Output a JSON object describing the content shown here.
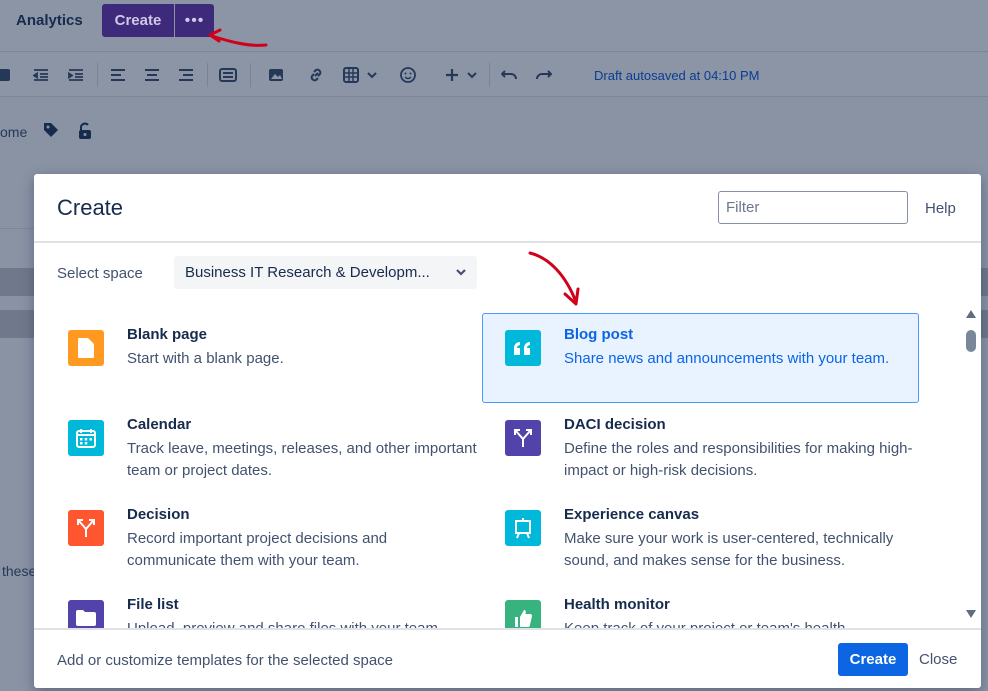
{
  "topbar": {
    "analytics_label": "Analytics",
    "create_label": "Create",
    "more_label": "•••"
  },
  "toolbar": {
    "draft_status": "Draft autosaved at 04:10 PM",
    "icons": [
      "checkbox-icon",
      "outdent-icon",
      "indent-icon",
      "align-left-icon",
      "align-center-icon",
      "align-right-icon",
      "layout-icon",
      "image-icon",
      "link-icon",
      "table-icon",
      "chevron-down-icon",
      "emoji-icon",
      "plus-icon",
      "chevron-down-icon",
      "undo-icon",
      "redo-icon"
    ]
  },
  "page": {
    "partial_home_text": "ome",
    "partial_body_text": "these"
  },
  "modal": {
    "title": "Create",
    "filter_placeholder": "Filter",
    "help_label": "Help",
    "select_space_label": "Select space",
    "selected_space": "Business IT Research & Developm...",
    "templates": [
      {
        "title": "Blank page",
        "description": "Start with a blank page.",
        "icon": "blank-page-icon",
        "color": "#ff991f",
        "selected": false
      },
      {
        "title": "Blog post",
        "description": "Share news and announcements with your team.",
        "icon": "quote-icon",
        "color": "#00b8d9",
        "selected": true
      },
      {
        "title": "Calendar",
        "description": "Track leave, meetings, releases, and other important team or project dates.",
        "icon": "calendar-icon",
        "color": "#00b8d9",
        "selected": false
      },
      {
        "title": "DACI decision",
        "description": "Define the roles and responsibilities for making high-impact or high-risk decisions.",
        "icon": "decision-fork-icon",
        "color": "#5243aa",
        "selected": false
      },
      {
        "title": "Decision",
        "description": "Record important project decisions and communicate them with your team.",
        "icon": "decision-fork-icon",
        "color": "#ff5630",
        "selected": false
      },
      {
        "title": "Experience canvas",
        "description": "Make sure your work is user-centered, technically sound, and makes sense for the business.",
        "icon": "canvas-icon",
        "color": "#00b8d9",
        "selected": false
      },
      {
        "title": "File list",
        "description": "Upload, preview and share files with your team.",
        "icon": "folder-icon",
        "color": "#5243aa",
        "selected": false
      },
      {
        "title": "Health monitor",
        "description": "Keep track of your project or team's health.",
        "icon": "thumbs-up-icon",
        "color": "#36b37e",
        "selected": false
      }
    ],
    "footer_text": "Add or customize templates for the selected space",
    "create_label": "Create",
    "close_label": "Close"
  },
  "colors": {
    "overlay": "#8993a4",
    "primary": "#0c66e4",
    "purple_button": "#3e2a7a",
    "annotation": "#d0021b"
  }
}
